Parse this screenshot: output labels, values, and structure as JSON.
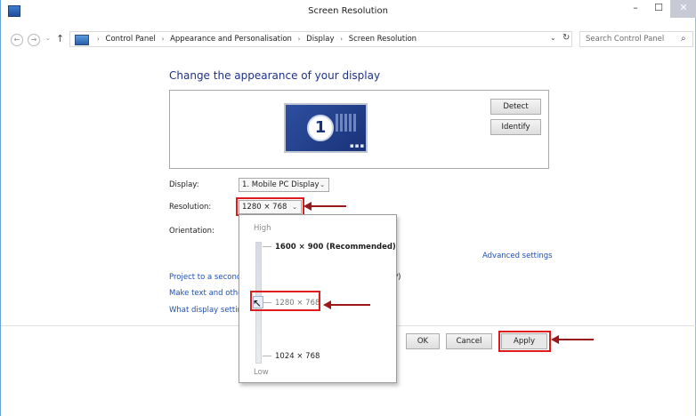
{
  "window": {
    "title": "Screen Resolution",
    "min": "–",
    "max": "☐",
    "close": "✕"
  },
  "nav": {
    "back": "←",
    "forward": "→",
    "recent": "⌄",
    "up": "↑",
    "breadcrumbs": [
      "Control Panel",
      "Appearance and Personalisation",
      "Display",
      "Screen Resolution"
    ],
    "separator": "›",
    "dropdown": "⌄",
    "refresh": "↻",
    "search_placeholder": "Search Control Panel",
    "search_icon": "⌕"
  },
  "main": {
    "heading": "Change the appearance of your display",
    "monitor_number": "1",
    "monitor_dots": "▪▪▪",
    "detect": "Detect",
    "identify": "Identify",
    "display_label": "Display:",
    "display_value": "1. Mobile PC Display",
    "resolution_label": "Resolution:",
    "resolution_value": "1280 × 768",
    "orientation_label": "Orientation:",
    "chevron": "⌄",
    "advanced_settings": "Advanced settings",
    "links": [
      "Project to a second",
      "Make text and other",
      "What display setting"
    ],
    "link1_suffix": "P)"
  },
  "dropdown": {
    "high": "High",
    "low": "Low",
    "options": [
      "1600 × 900 (Recommended)",
      "1280 × 768",
      "1024 × 768"
    ]
  },
  "buttons": {
    "ok": "OK",
    "cancel": "Cancel",
    "apply": "Apply"
  },
  "cursor": "↖",
  "colors": {
    "highlight": "#e01b1b",
    "arrow": "#9b1818",
    "link": "#1e4fb5",
    "heading": "#1e3287"
  }
}
